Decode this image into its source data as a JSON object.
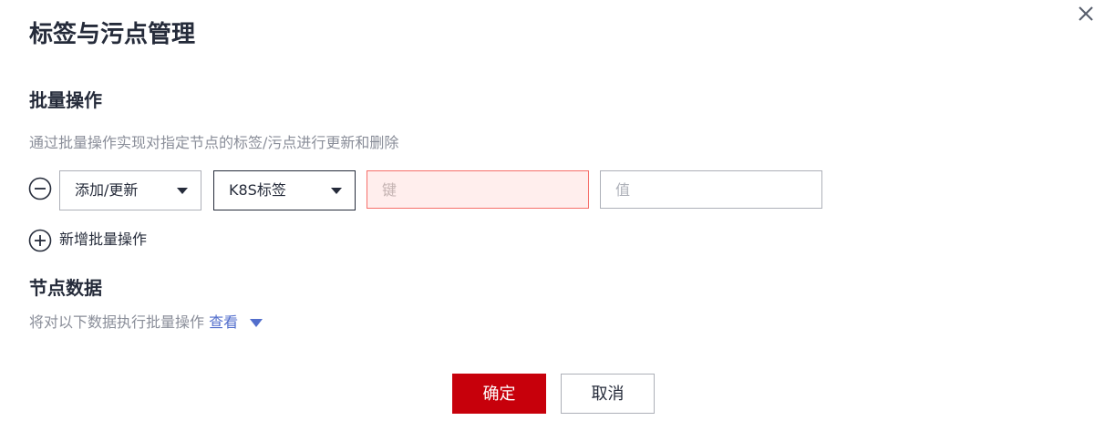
{
  "dialog": {
    "title": "标签与污点管理",
    "close_icon": "close-icon"
  },
  "batch": {
    "heading": "批量操作",
    "description": "通过批量操作实现对指定节点的标签/污点进行更新和删除",
    "row": {
      "remove_icon": "minus-circle-icon",
      "action_select": "添加/更新",
      "type_select": "K8S标签",
      "key_placeholder": "键",
      "key_value": "",
      "value_placeholder": "值",
      "value_value": ""
    },
    "add_label": "新增批量操作",
    "add_icon": "plus-circle-icon"
  },
  "node_data": {
    "heading": "节点数据",
    "description": "将对以下数据执行批量操作",
    "view_link": "查看",
    "view_icon": "caret-down-icon"
  },
  "footer": {
    "confirm_label": "确定",
    "cancel_label": "取消"
  },
  "colors": {
    "primary": "#c7000b",
    "link": "#526ecc",
    "error_bg": "#ffeeed",
    "error_border": "#f66f6a"
  }
}
